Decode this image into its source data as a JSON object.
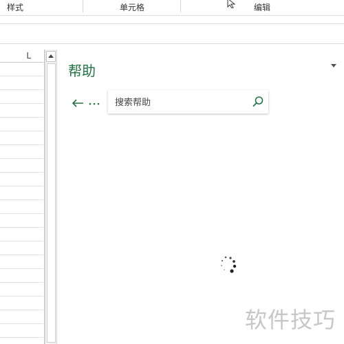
{
  "ribbon": {
    "groups": [
      {
        "label": "样式"
      },
      {
        "label": "单元格"
      },
      {
        "label": "编辑"
      }
    ]
  },
  "sheet": {
    "column_header": "L"
  },
  "help_pane": {
    "title": "帮助",
    "search_placeholder": "搜索帮助",
    "accent_color": "#217346",
    "status": "loading"
  },
  "watermark": {
    "text": "软件技巧"
  }
}
